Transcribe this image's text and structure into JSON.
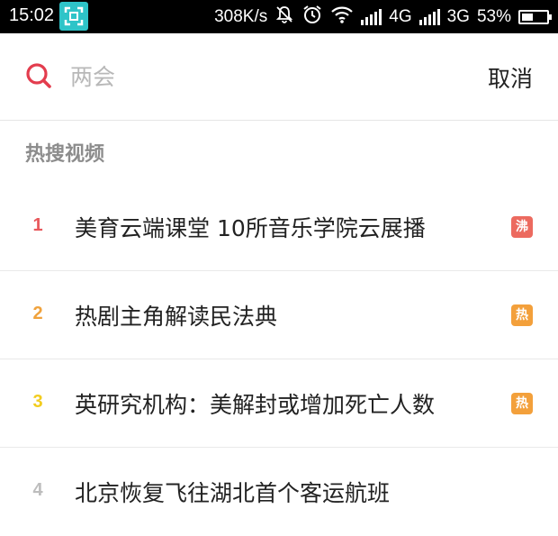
{
  "status_bar": {
    "time": "15:02",
    "speed": "308K/s",
    "network1": "4G",
    "network2": "3G",
    "battery": "53%",
    "battery_level": 0.53
  },
  "search": {
    "placeholder": "两会",
    "cancel_label": "取消"
  },
  "section": {
    "title": "热搜视频"
  },
  "colors": {
    "rank_1": "#e8585c",
    "rank_2": "#f0a23c",
    "rank_3": "#f2cc1e",
    "rank_4": "#bdbdbd",
    "badge_boil": "#ec6a5f",
    "badge_hot": "#f3a03b",
    "search_icon": "#e33d4e"
  },
  "items": [
    {
      "rank": "1",
      "title": "美育云端课堂 10所音乐学院云展播",
      "badge": "沸"
    },
    {
      "rank": "2",
      "title": "热剧主角解读民法典",
      "badge": "热"
    },
    {
      "rank": "3",
      "title": "英研究机构：美解封或增加死亡人数",
      "badge": "热"
    },
    {
      "rank": "4",
      "title": "北京恢复飞往湖北首个客运航班",
      "badge": ""
    }
  ]
}
